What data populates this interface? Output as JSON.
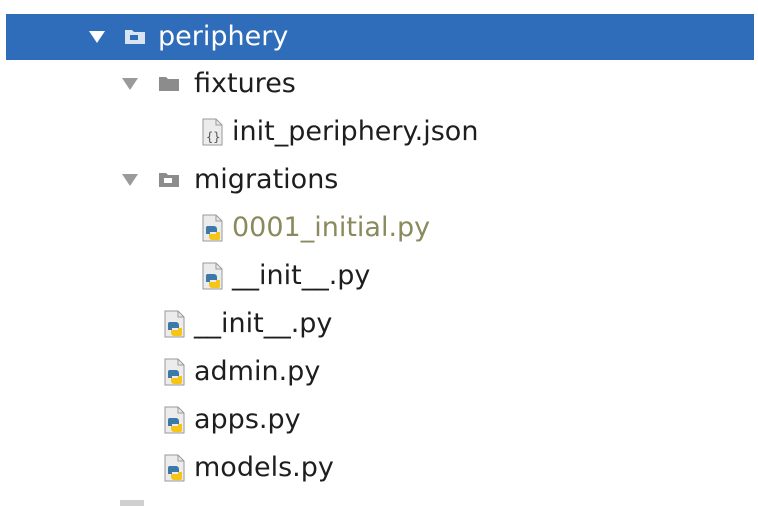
{
  "tree": {
    "items": [
      {
        "label": "periphery",
        "type": "folder",
        "expanded": true,
        "selected": true,
        "icon": "folder-icon"
      },
      {
        "label": "fixtures",
        "type": "folder",
        "expanded": true,
        "icon": "folder-icon"
      },
      {
        "label": "init_periphery.json",
        "type": "json-file",
        "icon": "json-file-icon"
      },
      {
        "label": "migrations",
        "type": "folder",
        "expanded": true,
        "icon": "folder-icon"
      },
      {
        "label": "0001_initial.py",
        "type": "python-file",
        "icon": "python-file-icon",
        "status": "unversioned"
      },
      {
        "label": "__init__.py",
        "type": "python-file",
        "icon": "python-file-icon"
      },
      {
        "label": "__init__.py",
        "type": "python-file",
        "icon": "python-file-icon"
      },
      {
        "label": "admin.py",
        "type": "python-file",
        "icon": "python-file-icon"
      },
      {
        "label": "apps.py",
        "type": "python-file",
        "icon": "python-file-icon"
      },
      {
        "label": "models.py",
        "type": "python-file",
        "icon": "python-file-icon"
      }
    ]
  },
  "colors": {
    "selection": "#2f6dba",
    "text": "#1e1e1e",
    "unversioned_text": "#8a8a5e",
    "folder_icon": "#8c8c8c"
  }
}
